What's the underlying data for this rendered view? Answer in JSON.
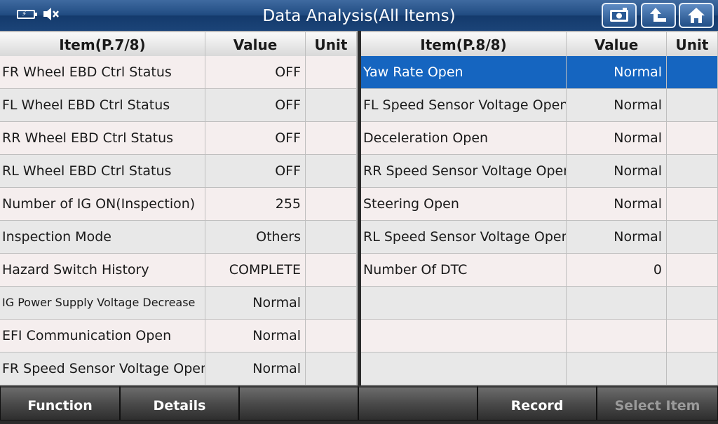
{
  "header": {
    "title": "Data Analysis(All Items)",
    "icons": [
      "battery-charging-icon",
      "speaker-muted-icon",
      "screenshot-icon",
      "back-arrow-icon",
      "home-icon"
    ]
  },
  "left_table": {
    "headers": {
      "item": "Item(P.7/8)",
      "value": "Value",
      "unit": "Unit"
    },
    "rows": [
      {
        "item": "FR Wheel EBD Ctrl Status",
        "value": "OFF",
        "unit": ""
      },
      {
        "item": "FL Wheel EBD Ctrl Status",
        "value": "OFF",
        "unit": ""
      },
      {
        "item": "RR Wheel EBD Ctrl Status",
        "value": "OFF",
        "unit": ""
      },
      {
        "item": "RL Wheel EBD Ctrl Status",
        "value": "OFF",
        "unit": ""
      },
      {
        "item": "Number of IG ON(Inspection)",
        "value": "255",
        "unit": ""
      },
      {
        "item": "Inspection Mode",
        "value": "Others",
        "unit": ""
      },
      {
        "item": "Hazard Switch History",
        "value": "COMPLETE",
        "unit": ""
      },
      {
        "item": "IG Power Supply Voltage Decrease",
        "value": "Normal",
        "unit": ""
      },
      {
        "item": "EFI Communication Open",
        "value": "Normal",
        "unit": ""
      },
      {
        "item": "FR Speed Sensor Voltage Open",
        "value": "Normal",
        "unit": ""
      }
    ]
  },
  "right_table": {
    "headers": {
      "item": "Item(P.8/8)",
      "value": "Value",
      "unit": "Unit"
    },
    "rows": [
      {
        "item": "Yaw Rate Open",
        "value": "Normal",
        "unit": ""
      },
      {
        "item": "FL Speed Sensor Voltage Open",
        "value": "Normal",
        "unit": ""
      },
      {
        "item": "Deceleration Open",
        "value": "Normal",
        "unit": ""
      },
      {
        "item": "RR Speed Sensor Voltage Open",
        "value": "Normal",
        "unit": ""
      },
      {
        "item": "Steering Open",
        "value": "Normal",
        "unit": ""
      },
      {
        "item": "RL Speed Sensor Voltage Open",
        "value": "Normal",
        "unit": ""
      },
      {
        "item": "Number Of DTC",
        "value": "0",
        "unit": ""
      },
      {
        "item": "",
        "value": "",
        "unit": ""
      },
      {
        "item": "",
        "value": "",
        "unit": ""
      },
      {
        "item": "",
        "value": "",
        "unit": ""
      }
    ],
    "selected_row": 0
  },
  "footer": {
    "buttons": [
      {
        "label": "Function",
        "enabled": true
      },
      {
        "label": "Details",
        "enabled": true
      },
      {
        "label": "",
        "enabled": true
      },
      {
        "label": "",
        "enabled": true
      },
      {
        "label": "Record",
        "enabled": true
      },
      {
        "label": "Select Item",
        "enabled": false
      }
    ]
  },
  "colors": {
    "selection": "#1565c0",
    "title_bar": "#214c82"
  }
}
